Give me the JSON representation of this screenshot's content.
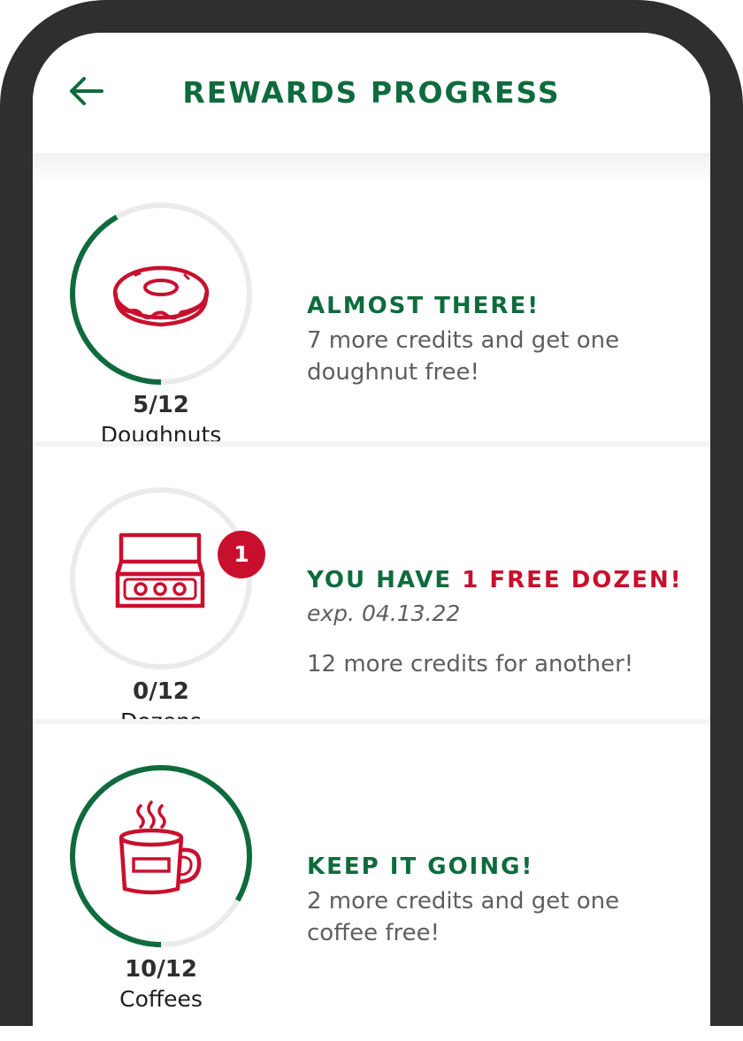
{
  "header": {
    "title": "REWARDS PROGRESS",
    "back_icon": "arrow-left-icon"
  },
  "colors": {
    "brand_green": "#0f6b3d",
    "accent_red": "#c8102e",
    "ring_track": "#ebebeb",
    "bezel": "#2f2f2f"
  },
  "rewards": [
    {
      "icon": "doughnut-icon",
      "count": "5/12",
      "progress": 0.4167,
      "unit": "Doughnuts",
      "headline": "ALMOST THERE!",
      "message": "7 more credits and get one doughnut free!"
    },
    {
      "icon": "dozen-box-icon",
      "count": "0/12",
      "progress": 0,
      "unit": "Dozens",
      "badge": "1",
      "headline_prefix": "YOU HAVE ",
      "headline_highlight": "1 FREE DOZEN",
      "headline_suffix": "!",
      "expiry": "exp. 04.13.22",
      "message": "12 more credits for another!"
    },
    {
      "icon": "coffee-mug-icon",
      "count": "10/12",
      "progress": 0.8333,
      "unit": "Coffees",
      "headline": "KEEP IT GOING!",
      "message": "2 more credits and get one coffee free!"
    }
  ]
}
